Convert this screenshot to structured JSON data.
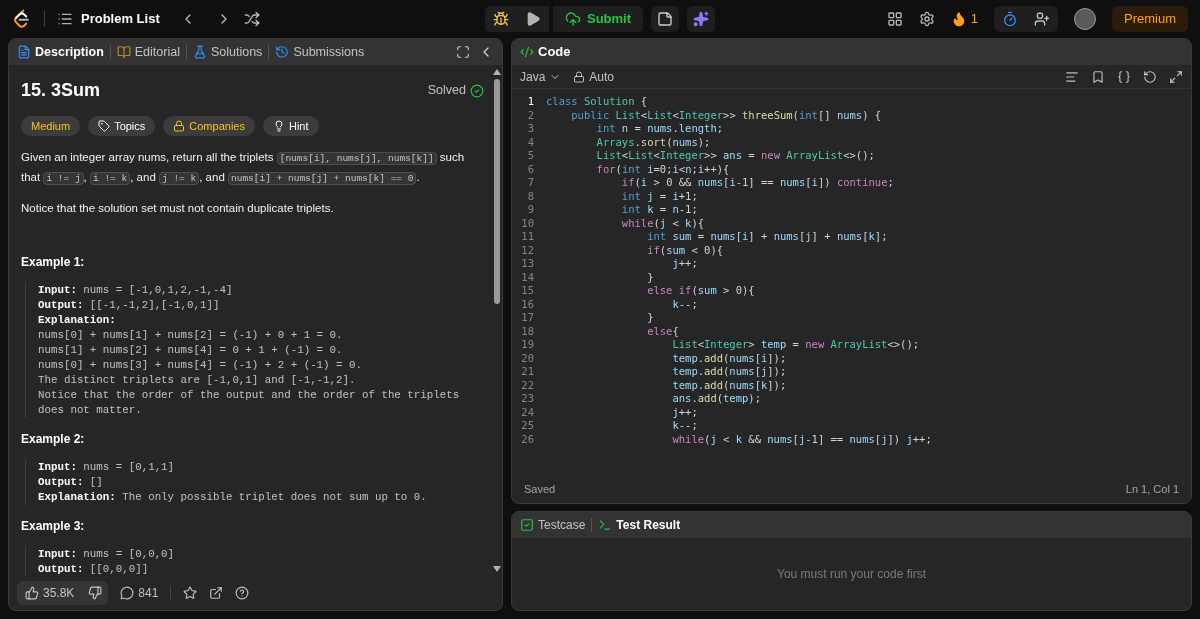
{
  "topbar": {
    "problem_list": "Problem List",
    "submit": "Submit",
    "streak": "1",
    "premium": "Premium"
  },
  "description_panel": {
    "tabs": [
      {
        "label": "Description",
        "selected": true
      },
      {
        "label": "Editorial",
        "selected": false
      },
      {
        "label": "Solutions",
        "selected": false
      },
      {
        "label": "Submissions",
        "selected": false
      }
    ],
    "title": "15. 3Sum",
    "status": "Solved",
    "tags": [
      {
        "kind": "difficulty",
        "label": "Medium"
      },
      {
        "kind": "topics",
        "label": "Topics"
      },
      {
        "kind": "companies",
        "label": "Companies"
      },
      {
        "kind": "hint",
        "label": "Hint"
      }
    ],
    "statement": [
      {
        "kind": "plain",
        "text": "Given an integer array nums, return all the triplets "
      },
      {
        "kind": "code",
        "text": "[nums[i], nums[j], nums[k]]"
      },
      {
        "kind": "plain",
        "text": " such that "
      },
      {
        "kind": "code",
        "text": "i != j"
      },
      {
        "kind": "plain",
        "text": ", "
      },
      {
        "kind": "code",
        "text": "i != k"
      },
      {
        "kind": "plain",
        "text": ", and "
      },
      {
        "kind": "code",
        "text": "j != k"
      },
      {
        "kind": "plain",
        "text": ", and "
      },
      {
        "kind": "code",
        "text": "nums[i] + nums[j] + nums[k] == 0"
      },
      {
        "kind": "plain",
        "text": "."
      }
    ],
    "notice": "Notice that the solution set must not contain duplicate triplets.",
    "examples": [
      {
        "title": "Example 1:",
        "lines": [
          "**Input:** nums = [-1,0,1,2,-1,-4]",
          "**Output:** [[-1,-1,2],[-1,0,1]]",
          "**Explanation:**",
          "nums[0] + nums[1] + nums[2] = (-1) + 0 + 1 = 0.",
          "nums[1] + nums[2] + nums[4] = 0 + 1 + (-1) = 0.",
          "nums[0] + nums[3] + nums[4] = (-1) + 2 + (-1) = 0.",
          "The distinct triplets are [-1,0,1] and [-1,-1,2].",
          "Notice that the order of the output and the order of the triplets does not matter."
        ]
      },
      {
        "title": "Example 2:",
        "lines": [
          "**Input:** nums = [0,1,1]",
          "**Output:** []",
          "**Explanation:** The only possible triplet does not sum up to 0."
        ]
      },
      {
        "title": "Example 3:",
        "lines": [
          "**Input:** nums = [0,0,0]",
          "**Output:** [[0,0,0]]"
        ]
      }
    ],
    "likes": "35.8K",
    "comments": "841"
  },
  "code_panel": {
    "title": "Code",
    "language": "Java",
    "mode": "Auto",
    "lines": [
      {
        "num": "1",
        "current": true,
        "tokens": [
          {
            "kind": "kw",
            "text": "class "
          },
          {
            "kind": "type",
            "text": "Solution"
          },
          {
            "kind": "p",
            "text": " {"
          }
        ]
      },
      {
        "num": "2",
        "current": false,
        "tokens": [
          {
            "kind": "kw",
            "text": "    public "
          },
          {
            "kind": "type",
            "text": "List"
          },
          {
            "kind": "p",
            "text": "<"
          },
          {
            "kind": "type",
            "text": "List"
          },
          {
            "kind": "p",
            "text": "<"
          },
          {
            "kind": "type",
            "text": "Integer"
          },
          {
            "kind": "p",
            "text": ">> "
          },
          {
            "kind": "fn",
            "text": "threeSum"
          },
          {
            "kind": "p",
            "text": "("
          },
          {
            "kind": "kw",
            "text": "int"
          },
          {
            "kind": "p",
            "text": "[] "
          },
          {
            "kind": "var",
            "text": "nums"
          },
          {
            "kind": "p",
            "text": ") {"
          }
        ]
      },
      {
        "num": "3",
        "current": false,
        "tokens": [
          {
            "kind": "kw",
            "text": "        int "
          },
          {
            "kind": "var",
            "text": "n"
          },
          {
            "kind": "p",
            "text": " = "
          },
          {
            "kind": "var",
            "text": "nums"
          },
          {
            "kind": "p",
            "text": "."
          },
          {
            "kind": "var",
            "text": "length"
          },
          {
            "kind": "p",
            "text": ";"
          }
        ]
      },
      {
        "num": "4",
        "current": false,
        "tokens": [
          {
            "kind": "type",
            "text": "        Arrays"
          },
          {
            "kind": "p",
            "text": "."
          },
          {
            "kind": "fn",
            "text": "sort"
          },
          {
            "kind": "p",
            "text": "("
          },
          {
            "kind": "var",
            "text": "nums"
          },
          {
            "kind": "p",
            "text": ");"
          }
        ]
      },
      {
        "num": "5",
        "current": false,
        "tokens": [
          {
            "kind": "type",
            "text": "        List"
          },
          {
            "kind": "p",
            "text": "<"
          },
          {
            "kind": "type",
            "text": "List"
          },
          {
            "kind": "p",
            "text": "<"
          },
          {
            "kind": "type",
            "text": "Integer"
          },
          {
            "kind": "p",
            "text": ">> "
          },
          {
            "kind": "var",
            "text": "ans"
          },
          {
            "kind": "p",
            "text": " = "
          },
          {
            "kind": "ctl",
            "text": "new "
          },
          {
            "kind": "type",
            "text": "ArrayList"
          },
          {
            "kind": "p",
            "text": "<>();"
          }
        ]
      },
      {
        "num": "6",
        "current": false,
        "tokens": [
          {
            "kind": "ctl",
            "text": "        for"
          },
          {
            "kind": "p",
            "text": "("
          },
          {
            "kind": "kw",
            "text": "int "
          },
          {
            "kind": "var",
            "text": "i"
          },
          {
            "kind": "p",
            "text": "=0;"
          },
          {
            "kind": "var",
            "text": "i"
          },
          {
            "kind": "p",
            "text": "<"
          },
          {
            "kind": "var",
            "text": "n"
          },
          {
            "kind": "p",
            "text": ";"
          },
          {
            "kind": "var",
            "text": "i"
          },
          {
            "kind": "p",
            "text": "++){"
          }
        ]
      },
      {
        "num": "7",
        "current": false,
        "tokens": [
          {
            "kind": "ctl",
            "text": "            if"
          },
          {
            "kind": "p",
            "text": "("
          },
          {
            "kind": "var",
            "text": "i"
          },
          {
            "kind": "p",
            "text": " > 0 && "
          },
          {
            "kind": "var",
            "text": "nums"
          },
          {
            "kind": "p",
            "text": "["
          },
          {
            "kind": "var",
            "text": "i"
          },
          {
            "kind": "p",
            "text": "-1] == "
          },
          {
            "kind": "var",
            "text": "nums"
          },
          {
            "kind": "p",
            "text": "["
          },
          {
            "kind": "var",
            "text": "i"
          },
          {
            "kind": "p",
            "text": "]) "
          },
          {
            "kind": "ctl",
            "text": "continue"
          },
          {
            "kind": "p",
            "text": ";"
          }
        ]
      },
      {
        "num": "8",
        "current": false,
        "tokens": [
          {
            "kind": "kw",
            "text": "            int "
          },
          {
            "kind": "var",
            "text": "j"
          },
          {
            "kind": "p",
            "text": " = "
          },
          {
            "kind": "var",
            "text": "i"
          },
          {
            "kind": "p",
            "text": "+1;"
          }
        ]
      },
      {
        "num": "9",
        "current": false,
        "tokens": [
          {
            "kind": "kw",
            "text": "            int "
          },
          {
            "kind": "var",
            "text": "k"
          },
          {
            "kind": "p",
            "text": " = "
          },
          {
            "kind": "var",
            "text": "n"
          },
          {
            "kind": "p",
            "text": "-1;"
          }
        ]
      },
      {
        "num": "10",
        "current": false,
        "tokens": [
          {
            "kind": "ctl",
            "text": "            while"
          },
          {
            "kind": "p",
            "text": "("
          },
          {
            "kind": "var",
            "text": "j"
          },
          {
            "kind": "p",
            "text": " < "
          },
          {
            "kind": "var",
            "text": "k"
          },
          {
            "kind": "p",
            "text": "){"
          }
        ]
      },
      {
        "num": "11",
        "current": false,
        "tokens": [
          {
            "kind": "kw",
            "text": "                int "
          },
          {
            "kind": "var",
            "text": "sum"
          },
          {
            "kind": "p",
            "text": " = "
          },
          {
            "kind": "var",
            "text": "nums"
          },
          {
            "kind": "p",
            "text": "["
          },
          {
            "kind": "var",
            "text": "i"
          },
          {
            "kind": "p",
            "text": "] + "
          },
          {
            "kind": "var",
            "text": "nums"
          },
          {
            "kind": "p",
            "text": "["
          },
          {
            "kind": "var",
            "text": "j"
          },
          {
            "kind": "p",
            "text": "] + "
          },
          {
            "kind": "var",
            "text": "nums"
          },
          {
            "kind": "p",
            "text": "["
          },
          {
            "kind": "var",
            "text": "k"
          },
          {
            "kind": "p",
            "text": "];"
          }
        ]
      },
      {
        "num": "12",
        "current": false,
        "tokens": [
          {
            "kind": "ctl",
            "text": "                if"
          },
          {
            "kind": "p",
            "text": "("
          },
          {
            "kind": "var",
            "text": "sum"
          },
          {
            "kind": "p",
            "text": " < 0){"
          }
        ]
      },
      {
        "num": "13",
        "current": false,
        "tokens": [
          {
            "kind": "var",
            "text": "                    j"
          },
          {
            "kind": "p",
            "text": "++;"
          }
        ]
      },
      {
        "num": "14",
        "current": false,
        "tokens": [
          {
            "kind": "p",
            "text": "                }"
          }
        ]
      },
      {
        "num": "15",
        "current": false,
        "tokens": [
          {
            "kind": "ctl",
            "text": "                else if"
          },
          {
            "kind": "p",
            "text": "("
          },
          {
            "kind": "var",
            "text": "sum"
          },
          {
            "kind": "p",
            "text": " > 0){"
          }
        ]
      },
      {
        "num": "16",
        "current": false,
        "tokens": [
          {
            "kind": "var",
            "text": "                    k"
          },
          {
            "kind": "p",
            "text": "--;"
          }
        ]
      },
      {
        "num": "17",
        "current": false,
        "tokens": [
          {
            "kind": "p",
            "text": "                }"
          }
        ]
      },
      {
        "num": "18",
        "current": false,
        "tokens": [
          {
            "kind": "ctl",
            "text": "                else"
          },
          {
            "kind": "p",
            "text": "{"
          }
        ]
      },
      {
        "num": "19",
        "current": false,
        "tokens": [
          {
            "kind": "type",
            "text": "                    List"
          },
          {
            "kind": "p",
            "text": "<"
          },
          {
            "kind": "type",
            "text": "Integer"
          },
          {
            "kind": "p",
            "text": "> "
          },
          {
            "kind": "var",
            "text": "temp"
          },
          {
            "kind": "p",
            "text": " = "
          },
          {
            "kind": "ctl",
            "text": "new "
          },
          {
            "kind": "type",
            "text": "ArrayList"
          },
          {
            "kind": "p",
            "text": "<>();"
          }
        ]
      },
      {
        "num": "20",
        "current": false,
        "tokens": [
          {
            "kind": "var",
            "text": "                    temp"
          },
          {
            "kind": "p",
            "text": "."
          },
          {
            "kind": "fn",
            "text": "add"
          },
          {
            "kind": "p",
            "text": "("
          },
          {
            "kind": "var",
            "text": "nums"
          },
          {
            "kind": "p",
            "text": "["
          },
          {
            "kind": "var",
            "text": "i"
          },
          {
            "kind": "p",
            "text": "]);"
          }
        ]
      },
      {
        "num": "21",
        "current": false,
        "tokens": [
          {
            "kind": "var",
            "text": "                    temp"
          },
          {
            "kind": "p",
            "text": "."
          },
          {
            "kind": "fn",
            "text": "add"
          },
          {
            "kind": "p",
            "text": "("
          },
          {
            "kind": "var",
            "text": "nums"
          },
          {
            "kind": "p",
            "text": "["
          },
          {
            "kind": "var",
            "text": "j"
          },
          {
            "kind": "p",
            "text": "]);"
          }
        ]
      },
      {
        "num": "22",
        "current": false,
        "tokens": [
          {
            "kind": "var",
            "text": "                    temp"
          },
          {
            "kind": "p",
            "text": "."
          },
          {
            "kind": "fn",
            "text": "add"
          },
          {
            "kind": "p",
            "text": "("
          },
          {
            "kind": "var",
            "text": "nums"
          },
          {
            "kind": "p",
            "text": "["
          },
          {
            "kind": "var",
            "text": "k"
          },
          {
            "kind": "p",
            "text": "]);"
          }
        ]
      },
      {
        "num": "23",
        "current": false,
        "tokens": [
          {
            "kind": "var",
            "text": "                    ans"
          },
          {
            "kind": "p",
            "text": "."
          },
          {
            "kind": "fn",
            "text": "add"
          },
          {
            "kind": "p",
            "text": "("
          },
          {
            "kind": "var",
            "text": "temp"
          },
          {
            "kind": "p",
            "text": ");"
          }
        ]
      },
      {
        "num": "24",
        "current": false,
        "tokens": [
          {
            "kind": "var",
            "text": "                    j"
          },
          {
            "kind": "p",
            "text": "++;"
          }
        ]
      },
      {
        "num": "25",
        "current": false,
        "tokens": [
          {
            "kind": "var",
            "text": "                    k"
          },
          {
            "kind": "p",
            "text": "--;"
          }
        ]
      },
      {
        "num": "26",
        "current": false,
        "tokens": [
          {
            "kind": "ctl",
            "text": "                    while"
          },
          {
            "kind": "p",
            "text": "("
          },
          {
            "kind": "var",
            "text": "j"
          },
          {
            "kind": "p",
            "text": " < "
          },
          {
            "kind": "var",
            "text": "k"
          },
          {
            "kind": "p",
            "text": " && "
          },
          {
            "kind": "var",
            "text": "nums"
          },
          {
            "kind": "p",
            "text": "["
          },
          {
            "kind": "var",
            "text": "j"
          },
          {
            "kind": "p",
            "text": "-1] == "
          },
          {
            "kind": "var",
            "text": "nums"
          },
          {
            "kind": "p",
            "text": "["
          },
          {
            "kind": "var",
            "text": "j"
          },
          {
            "kind": "p",
            "text": "]) "
          },
          {
            "kind": "var",
            "text": "j"
          },
          {
            "kind": "p",
            "text": "++;"
          }
        ]
      }
    ],
    "save_status": "Saved",
    "cursor": "Ln 1, Col 1"
  },
  "test_panel": {
    "tabs": [
      {
        "label": "Testcase",
        "selected": false
      },
      {
        "label": "Test Result",
        "selected": true
      }
    ],
    "message": "You must run your code first"
  }
}
